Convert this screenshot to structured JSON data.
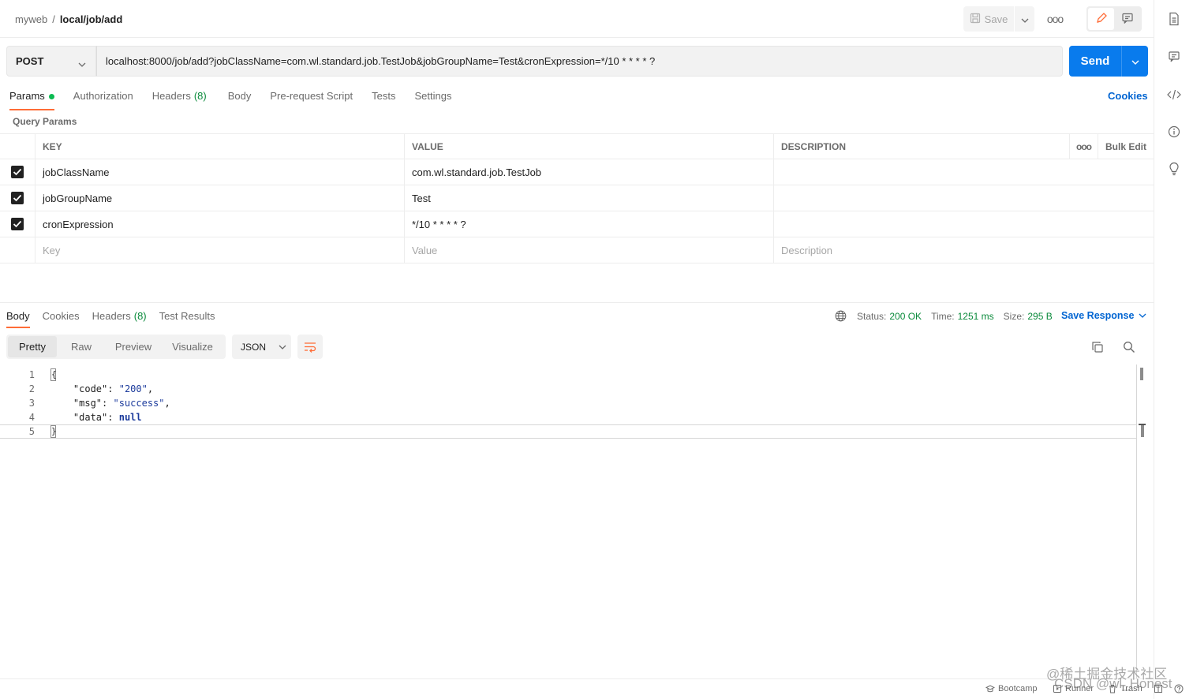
{
  "breadcrumb": {
    "workspace": "myweb",
    "separator": "/",
    "request": "local/job/add"
  },
  "toolbar": {
    "save_label": "Save",
    "more_label": "ooo"
  },
  "request": {
    "method": "POST",
    "url": "localhost:8000/job/add?jobClassName=com.wl.standard.job.TestJob&jobGroupName=Test&cronExpression=*/10 * * * * ?",
    "send_label": "Send"
  },
  "request_tabs": [
    {
      "label": "Params",
      "count": "",
      "active": true
    },
    {
      "label": "Authorization",
      "count": ""
    },
    {
      "label": "Headers",
      "count": "(8)"
    },
    {
      "label": "Body",
      "count": ""
    },
    {
      "label": "Pre-request Script",
      "count": ""
    },
    {
      "label": "Tests",
      "count": ""
    },
    {
      "label": "Settings",
      "count": ""
    }
  ],
  "cookies_link": "Cookies",
  "query_params": {
    "title": "Query Params",
    "headers": {
      "key": "KEY",
      "value": "VALUE",
      "description": "DESCRIPTION",
      "more": "ooo",
      "bulk_edit": "Bulk Edit"
    },
    "rows": [
      {
        "checked": true,
        "key": "jobClassName",
        "value": "com.wl.standard.job.TestJob",
        "description": ""
      },
      {
        "checked": true,
        "key": "jobGroupName",
        "value": "Test",
        "description": ""
      },
      {
        "checked": true,
        "key": "cronExpression",
        "value": "*/10 * * * * ?",
        "description": ""
      }
    ],
    "placeholders": {
      "key": "Key",
      "value": "Value",
      "description": "Description"
    }
  },
  "response_tabs": [
    {
      "label": "Body",
      "count": "",
      "active": true
    },
    {
      "label": "Cookies",
      "count": ""
    },
    {
      "label": "Headers",
      "count": "(8)"
    },
    {
      "label": "Test Results",
      "count": ""
    }
  ],
  "response_status": {
    "status_label": "Status:",
    "status_value": "200 OK",
    "time_label": "Time:",
    "time_value": "1251 ms",
    "size_label": "Size:",
    "size_value": "295 B",
    "save_response": "Save Response"
  },
  "view_tabs": [
    "Pretty",
    "Raw",
    "Preview",
    "Visualize"
  ],
  "format": "JSON",
  "code_lines": [
    {
      "num": "1"
    },
    {
      "num": "2",
      "key": "\"code\"",
      "sep": ": ",
      "val": "\"200\"",
      "end": ","
    },
    {
      "num": "3",
      "key": "\"msg\"",
      "sep": ": ",
      "val": "\"success\"",
      "end": ","
    },
    {
      "num": "4",
      "key": "\"data\"",
      "sep": ": ",
      "val": "null",
      "end": ""
    },
    {
      "num": "5"
    }
  ],
  "footer": {
    "bootcamp": "Bootcamp",
    "runner": "Runner",
    "trash": "Trash"
  },
  "watermark": {
    "line1": "@稀土掘金技术社区",
    "line2": "CSDN @wl_Honest"
  },
  "colors": {
    "accent": "#ff6c37",
    "send": "#097bed",
    "link": "#0265d2",
    "ok": "#0a8a3b"
  }
}
